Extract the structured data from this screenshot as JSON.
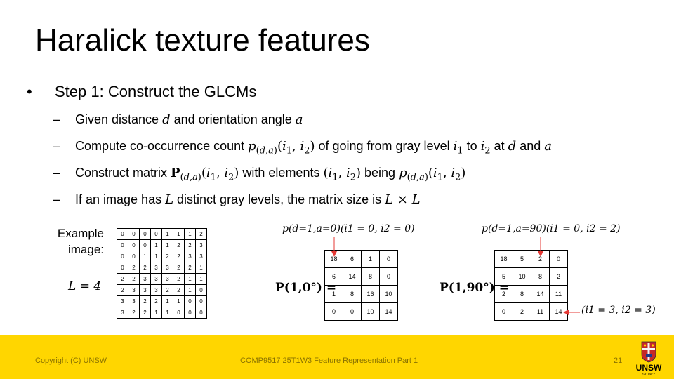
{
  "slide": {
    "title": "Haralick texture features"
  },
  "bullets": {
    "step1": "Step 1: Construct the GLCMs",
    "sub1_pre": "Given distance ",
    "sub1_mid": " and orientation angle ",
    "sub2_pre": "Compute co-occurrence count ",
    "sub2_mid1": " of going from gray level ",
    "sub2_mid2": " to ",
    "sub2_mid3": " at ",
    "sub2_mid4": " and ",
    "sub3_pre": "Construct matrix ",
    "sub3_mid1": " with elements ",
    "sub3_mid2": " being ",
    "sub4_pre": "If an image has ",
    "sub4_mid": " distinct gray levels, the matrix size is "
  },
  "example": {
    "label_line1": "Example",
    "label_line2": "image:",
    "L_value": "L = 4",
    "image": [
      [
        0,
        0,
        0,
        0,
        1,
        1,
        1,
        2
      ],
      [
        0,
        0,
        0,
        1,
        1,
        2,
        2,
        3
      ],
      [
        0,
        0,
        1,
        1,
        2,
        2,
        3,
        3
      ],
      [
        0,
        2,
        2,
        3,
        3,
        2,
        2,
        1
      ],
      [
        2,
        2,
        3,
        3,
        3,
        2,
        1,
        1
      ],
      [
        2,
        3,
        3,
        3,
        2,
        2,
        1,
        0
      ],
      [
        3,
        3,
        2,
        2,
        1,
        1,
        0,
        0
      ],
      [
        3,
        2,
        2,
        1,
        1,
        0,
        0,
        0
      ]
    ]
  },
  "matrices": {
    "p0_caption": "p(d=1,a=0)(i1 = 0, i2 = 0)",
    "p0_label": "P(1,0°) =",
    "p0": [
      [
        18,
        6,
        1,
        0
      ],
      [
        6,
        14,
        8,
        0
      ],
      [
        1,
        8,
        16,
        10
      ],
      [
        0,
        0,
        10,
        14
      ]
    ],
    "p90_caption": "p(d=1,a=90)(i1 = 0, i2 = 2)",
    "p90_label": "P(1,90°) =",
    "p90": [
      [
        18,
        5,
        2,
        0
      ],
      [
        5,
        10,
        8,
        2
      ],
      [
        2,
        8,
        14,
        11
      ],
      [
        0,
        2,
        11,
        14
      ]
    ],
    "p90_note": "(i1 = 3, i2 = 3)"
  },
  "footer": {
    "copyright": "Copyright (C) UNSW",
    "course": "COMP9517 25T1W3 Feature Representation Part 1",
    "page": "21",
    "logo_text": "UNSW",
    "logo_subtext": "SYDNEY"
  },
  "colors": {
    "footer_bg": "#ffd600",
    "arrow": "#e53935"
  }
}
